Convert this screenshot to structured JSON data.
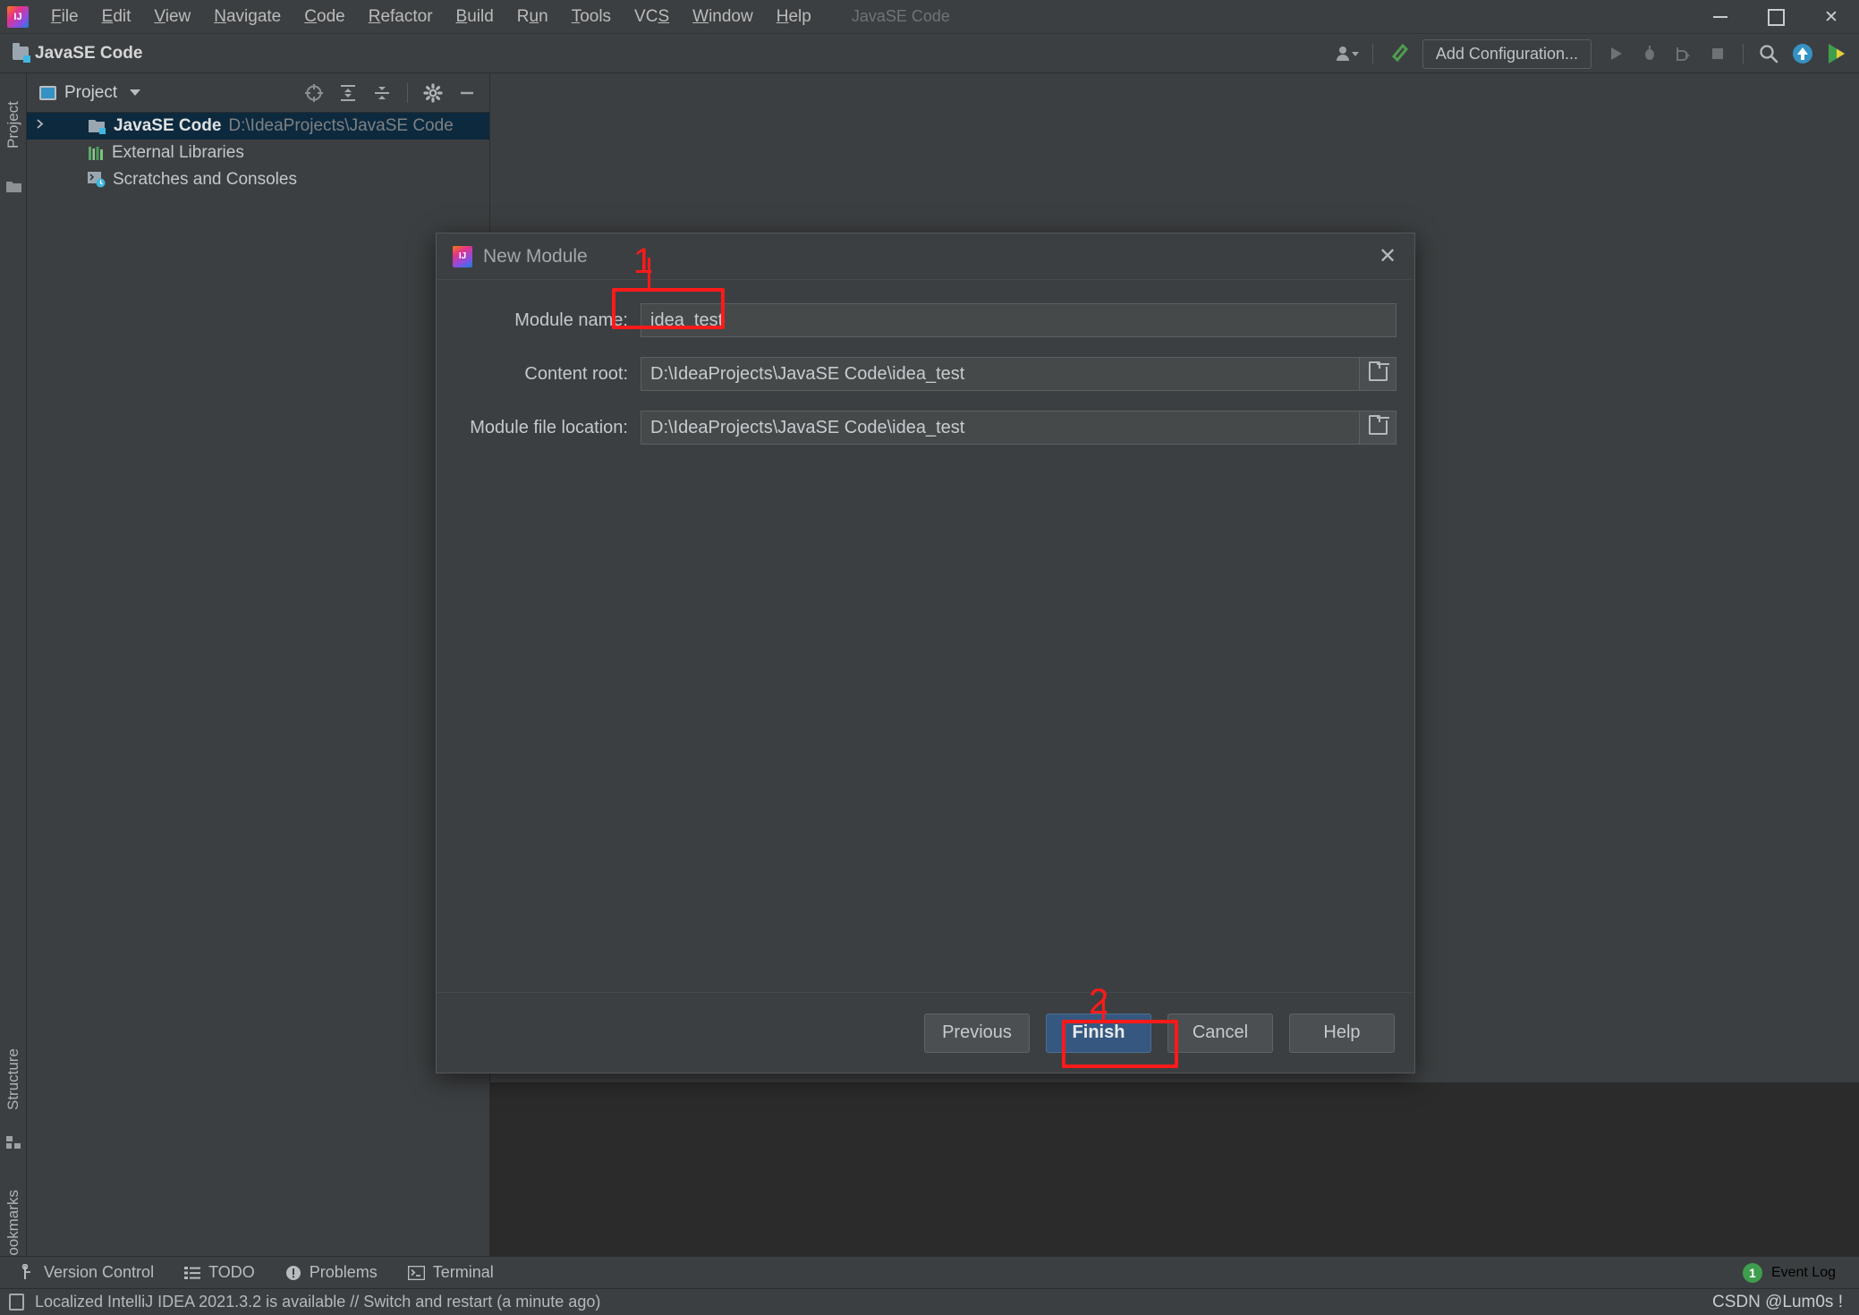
{
  "window": {
    "title": "JavaSE Code",
    "logo_text": "IJ",
    "controls": {
      "minimize": "minimize-icon",
      "maximize": "maximize-icon",
      "close": "X"
    }
  },
  "menubar": {
    "items": [
      {
        "label": "File",
        "mnemonic": "F"
      },
      {
        "label": "Edit",
        "mnemonic": "E"
      },
      {
        "label": "View",
        "mnemonic": "V"
      },
      {
        "label": "Navigate",
        "mnemonic": "N"
      },
      {
        "label": "Code",
        "mnemonic": "C"
      },
      {
        "label": "Refactor",
        "mnemonic": "R"
      },
      {
        "label": "Build",
        "mnemonic": "B"
      },
      {
        "label": "Run",
        "mnemonic": "u"
      },
      {
        "label": "Tools",
        "mnemonic": "T"
      },
      {
        "label": "VCS",
        "mnemonic": "S"
      },
      {
        "label": "Window",
        "mnemonic": "W"
      },
      {
        "label": "Help",
        "mnemonic": "H"
      }
    ]
  },
  "navbar": {
    "breadcrumb": "JavaSE Code",
    "run_config": "Add Configuration...",
    "icons": [
      "user-account-icon",
      "hammer-build-icon",
      "run-icon",
      "debug-icon",
      "run-with-coverage-icon",
      "stop-icon",
      "search-everywhere-icon",
      "update-project-icon",
      "ide-features-icon"
    ]
  },
  "sidebar": {
    "left_top": "Project",
    "left_bottom": [
      "Structure",
      "Bookmarks"
    ]
  },
  "project_panel": {
    "title": "Project",
    "toolbar_icons": [
      "select-opened-file-icon",
      "expand-all-icon",
      "collapse-all-icon",
      "settings-gear-icon",
      "hide-icon"
    ],
    "tree": [
      {
        "name": "JavaSE Code",
        "path": "D:\\IdeaProjects\\JavaSE Code",
        "icon": "project-folder-icon",
        "selected": true,
        "expandable": true
      },
      {
        "name": "External Libraries",
        "path": "",
        "icon": "libraries-icon",
        "selected": false,
        "expandable": false
      },
      {
        "name": "Scratches and Consoles",
        "path": "",
        "icon": "scratches-icon",
        "selected": false,
        "expandable": false
      }
    ]
  },
  "dialog": {
    "title": "New Module",
    "logo_text": "IJ",
    "close_label": "✕",
    "fields": [
      {
        "label": "Module name:",
        "value": "idea_test",
        "has_browse": false
      },
      {
        "label": "Content root:",
        "value": "D:\\IdeaProjects\\JavaSE Code\\idea_test",
        "has_browse": true
      },
      {
        "label": "Module file location:",
        "value": "D:\\IdeaProjects\\JavaSE Code\\idea_test",
        "has_browse": true
      }
    ],
    "buttons": [
      {
        "label": "Previous",
        "primary": false
      },
      {
        "label": "Finish",
        "primary": true
      },
      {
        "label": "Cancel",
        "primary": false
      },
      {
        "label": "Help",
        "primary": false
      }
    ]
  },
  "annotations": [
    {
      "number": "1",
      "target": "module-name-field"
    },
    {
      "number": "2",
      "target": "finish-button"
    }
  ],
  "toolwindow_bar": {
    "items": [
      {
        "label": "Version Control",
        "icon": "branch-icon"
      },
      {
        "label": "TODO",
        "icon": "list-icon"
      },
      {
        "label": "Problems",
        "icon": "warning-icon"
      },
      {
        "label": "Terminal",
        "icon": "terminal-icon"
      }
    ],
    "event_log": {
      "label": "Event Log",
      "count": "1"
    }
  },
  "statusbar": {
    "message": "Localized IntelliJ IDEA 2021.3.2 is available // Switch and restart (a minute ago)",
    "watermark": "CSDN @Lum0s !"
  },
  "colors": {
    "bg": "#3c3f41",
    "editor_bg": "#2b2b2b",
    "selection": "#0d293e",
    "primary_button": "#365880",
    "annotation_red": "#ff1a1a",
    "accent_blue": "#40b6e0"
  }
}
